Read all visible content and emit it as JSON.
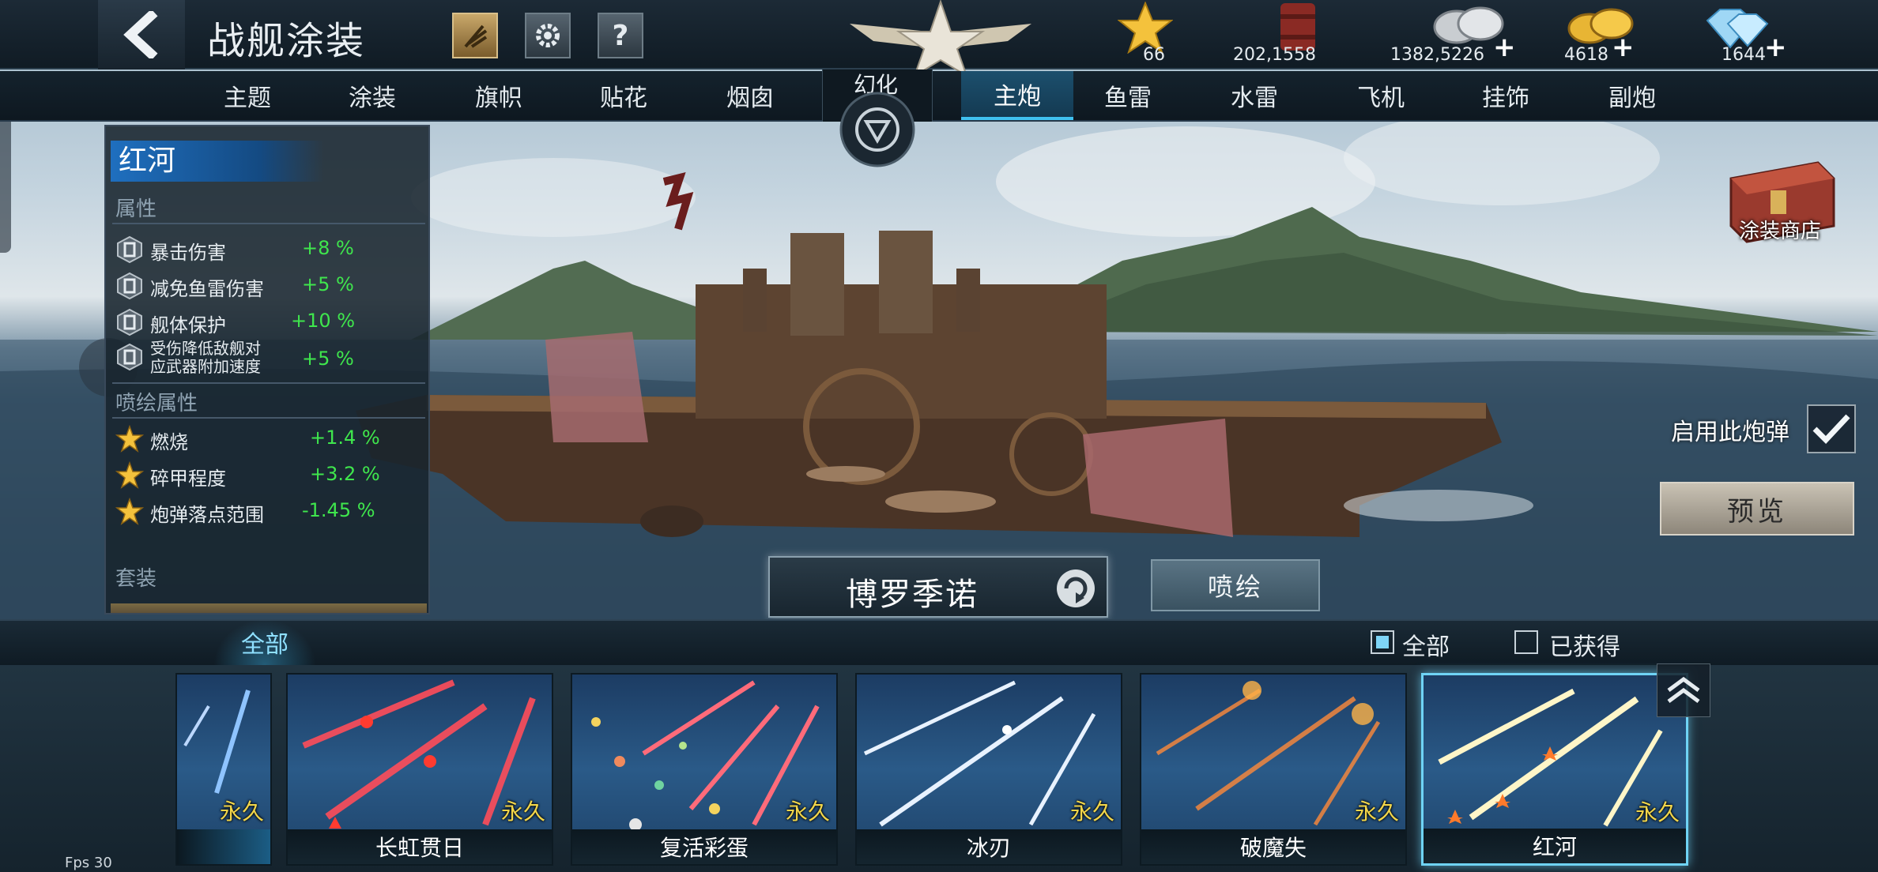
{
  "header": {
    "title": "战舰涂装",
    "resources": [
      {
        "name": "star-points",
        "value": "66",
        "icon": "star-icon"
      },
      {
        "name": "oil",
        "value": "202,1558",
        "icon": "oil-barrel-icon"
      },
      {
        "name": "silver",
        "value": "1382,5226",
        "icon": "silver-coins-icon",
        "plus": "+"
      },
      {
        "name": "gold",
        "value": "4618",
        "icon": "gold-coins-icon",
        "plus": "+"
      },
      {
        "name": "diamond",
        "value": "1644",
        "icon": "diamond-icon",
        "plus": "+"
      }
    ]
  },
  "tabs": {
    "left": [
      "主题",
      "涂装",
      "旗帜",
      "贴花",
      "烟囱"
    ],
    "middle": "幻化",
    "right": [
      "主炮",
      "鱼雷",
      "水雷",
      "飞机",
      "挂饰",
      "副炮"
    ],
    "active": "主炮"
  },
  "attributes": {
    "skin_name": "红河",
    "section_attr": "属性",
    "attrs": [
      {
        "name": "暴击伤害",
        "value": "+8 %"
      },
      {
        "name": "减免鱼雷伤害",
        "value": "+5 %"
      },
      {
        "name": "舰体保护",
        "value": "+10 %"
      },
      {
        "name": "受伤降低敌舰对\n应武器附加速度",
        "value": "+5 %"
      }
    ],
    "section_spray": "喷绘属性",
    "spray_attrs": [
      {
        "name": "燃烧",
        "value": "+1.4 %"
      },
      {
        "name": "碎甲程度",
        "value": "+3.2 %"
      },
      {
        "name": "炮弹落点范围",
        "value": "-1.45 %"
      }
    ],
    "section_set": "套装"
  },
  "right_panel": {
    "shop_label": "涂装商店",
    "use_shell_label": "启用此炮弹",
    "preview_label": "预览"
  },
  "ship": {
    "name": "博罗季诺",
    "spray_label": "喷绘"
  },
  "filter": {
    "tab_all": "全部",
    "opt_all": "全部",
    "opt_owned": "已获得"
  },
  "cards": [
    {
      "name": "",
      "tag": "永久",
      "color": "#5fa0ff"
    },
    {
      "name": "长虹贯日",
      "tag": "永久",
      "color": "#ff4d5a"
    },
    {
      "name": "复活彩蛋",
      "tag": "永久",
      "color": "#ff6b7a"
    },
    {
      "name": "冰刃",
      "tag": "永久",
      "color": "#e8f2ff"
    },
    {
      "name": "破魔失",
      "tag": "永久",
      "color": "#ff8a3a"
    },
    {
      "name": "红河",
      "tag": "永久",
      "color": "#fff6c8"
    }
  ],
  "status": {
    "fps": "Fps 30"
  }
}
